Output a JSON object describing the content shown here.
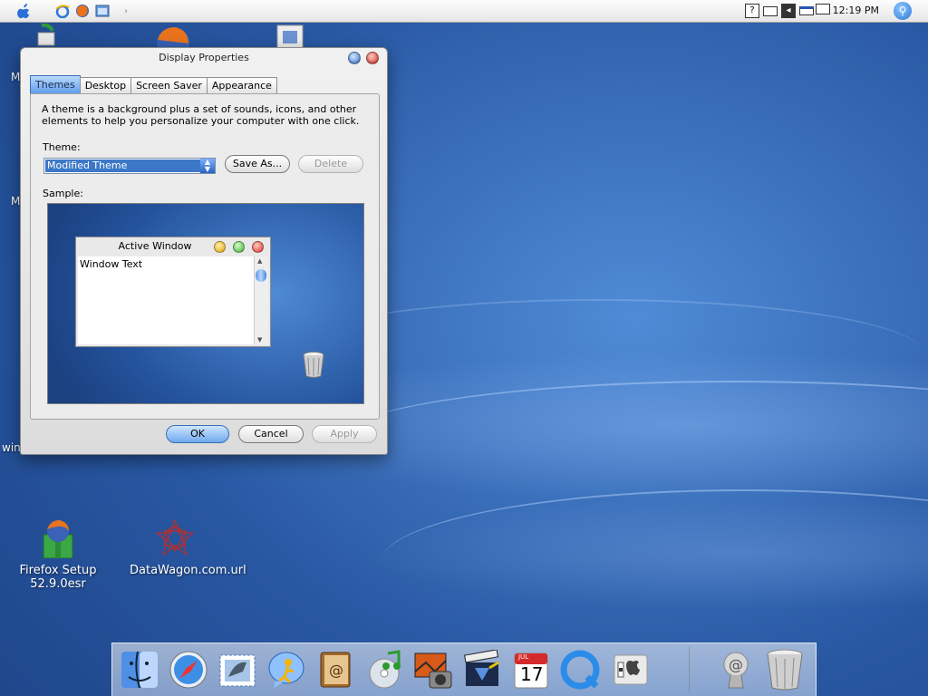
{
  "menubar": {
    "icons": [
      "apple-icon",
      "ie-icon",
      "firefox-icon",
      "explorer-icon",
      "chevron-right-icon"
    ],
    "tray": [
      "help-icon",
      "battery-icon",
      "volume-icon",
      "display-icon",
      "network-icon"
    ],
    "clock": "12:19 PM"
  },
  "desktop": {
    "partials": [
      "M",
      "M",
      "win"
    ],
    "icons": [
      {
        "label_line1": "Firefox Setup",
        "label_line2": "52.9.0esr",
        "icon": "firefox-setup-icon"
      },
      {
        "label_line1": "DataWagon.com.url",
        "label_line2": "",
        "icon": "datawagon-icon"
      }
    ]
  },
  "dialog": {
    "title": "Display Properties",
    "tabs": [
      {
        "label": "Themes",
        "active": true
      },
      {
        "label": "Desktop",
        "active": false
      },
      {
        "label": "Screen Saver",
        "active": false
      },
      {
        "label": "Appearance",
        "active": false
      }
    ],
    "description": "A theme is a background plus a set of sounds, icons, and other elements to help you personalize your computer with one click.",
    "theme_label": "Theme:",
    "theme_value": "Modified Theme",
    "save_as_label": "Save As...",
    "delete_label": "Delete",
    "sample_label": "Sample:",
    "sample": {
      "window_title": "Active Window",
      "window_text": "Window Text"
    },
    "ok_label": "OK",
    "cancel_label": "Cancel",
    "apply_label": "Apply"
  },
  "dock": {
    "items": [
      "finder-icon",
      "safari-icon",
      "mail-icon",
      "ichat-icon",
      "address-book-icon",
      "itunes-icon",
      "iphoto-icon",
      "imovie-icon",
      "ical-icon",
      "quicktime-icon",
      "system-preferences-icon",
      "mail-stamp-icon",
      "trash-icon"
    ],
    "ical_month": "JUL",
    "ical_day": "17"
  },
  "colors": {
    "desktop_blue": "#2b5fa8",
    "aqua_blue": "#3d78c8"
  }
}
